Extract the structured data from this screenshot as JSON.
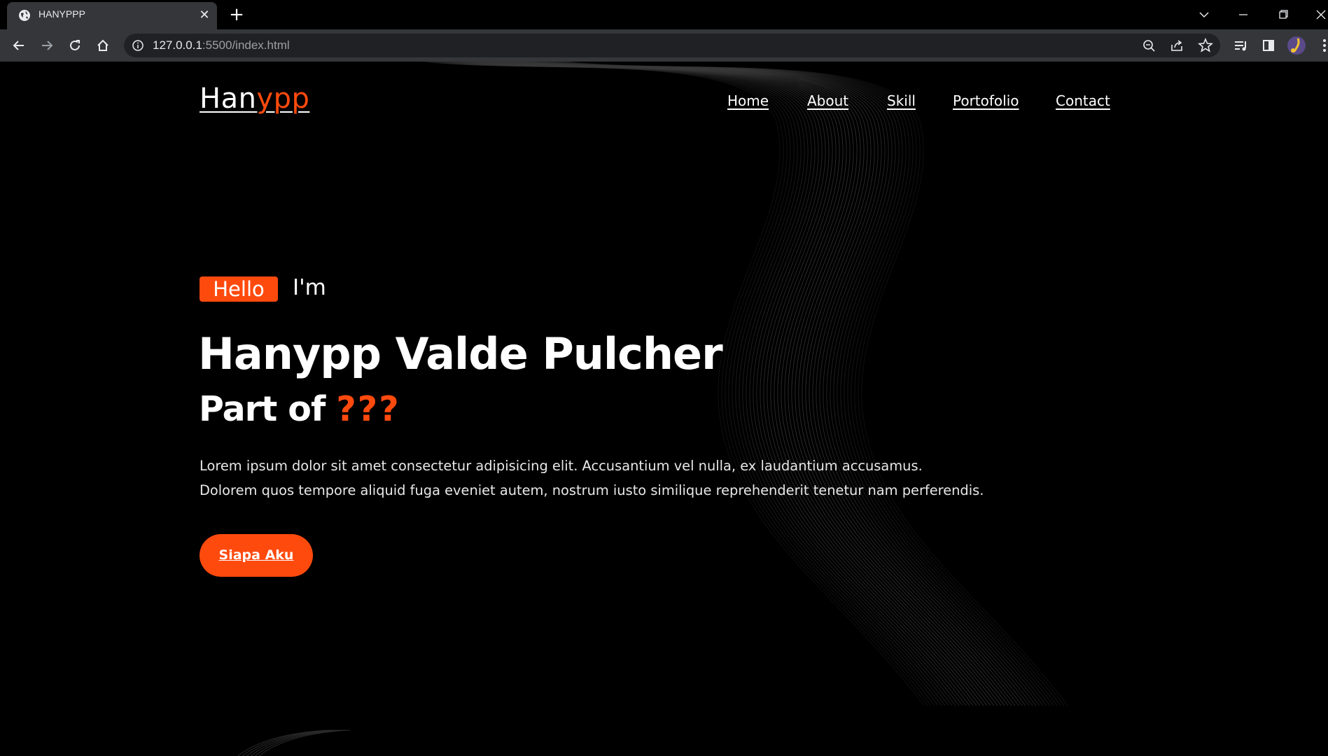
{
  "browser": {
    "tab": {
      "title": "HANYPPP",
      "favicon": "globe-icon",
      "close_icon": "close-icon"
    },
    "new_tab_icon": "plus-icon",
    "window_controls": [
      "chevron-down-icon",
      "minimize-icon",
      "restore-icon",
      "close-icon"
    ],
    "toolbar_icons": [
      "back-arrow-icon",
      "forward-arrow-icon",
      "reload-icon",
      "home-icon"
    ],
    "address": {
      "host": "127.0.0.1",
      "path": ":5500/index.html",
      "info_icon": "info-icon"
    },
    "omnibox_icons": [
      "zoom-icon",
      "share-icon",
      "bookmark-star-icon"
    ],
    "extension_icons": [
      "media-playlist-icon",
      "side-panel-icon",
      "profile-avatar-icon",
      "kebab-menu-icon"
    ]
  },
  "site": {
    "logo": {
      "primary": "Han",
      "accent": "ypp"
    },
    "nav": [
      {
        "label": "Home"
      },
      {
        "label": "About"
      },
      {
        "label": "Skill"
      },
      {
        "label": "Portofolio"
      },
      {
        "label": "Contact"
      }
    ],
    "hero": {
      "badge": "Hello",
      "im": "I'm",
      "name": "Hanypp Valde Pulcher",
      "part_of": "Part of ",
      "part_of_accent": "???",
      "description_lines": [
        "Lorem ipsum dolor sit amet consectetur adipisicing elit. Accusantium vel nulla, ex laudantium accusamus.",
        "Dolorem quos tempore aliquid fuga eveniet autem, nostrum iusto similique reprehenderit tenetur nam perferendis."
      ],
      "cta_label": "Siapa Aku"
    },
    "colors": {
      "accent": "#ff4a0e",
      "background": "#000000",
      "text": "#ffffff"
    }
  }
}
